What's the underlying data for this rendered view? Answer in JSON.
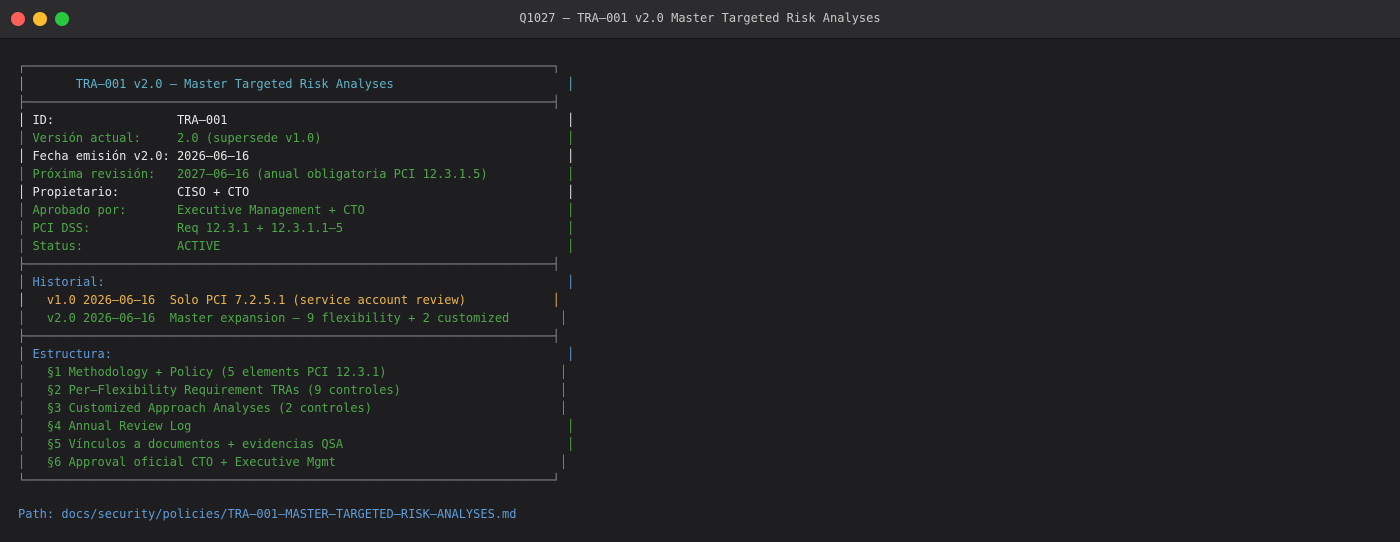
{
  "window": {
    "title": "Q1027 — TRA–001 v2.0 Master Targeted Risk Analyses"
  },
  "colors": {
    "accent_cyan": "#5fb3c9",
    "text_white": "#e6e6e6",
    "status_green": "#4fa64a",
    "history_yellow": "#e9b44c",
    "heading_blue": "#5f9bd8"
  },
  "terminal": {
    "lines": [
      "┌─────────────────────────────────────────────────────────────────────────┐",
      "│       TRA–001 v2.0 — Master Targeted Risk Analyses                        │",
      "├─────────────────────────────────────────────────────────────────────────┤",
      "│ ID:                 TRA–001                                               │",
      "│ Versión actual:     2.0 (supersede v1.0)                                  │",
      "│ Fecha emisión v2.0: 2026–06–16                                            │",
      "│ Próxima revisión:   2027–06–16 (anual obligatoria PCI 12.3.1.5)           │",
      "│ Propietario:        CISO + CTO                                            │",
      "│ Aprobado por:       Executive Management + CTO                            │",
      "│ PCI DSS:            Req 12.3.1 + 12.3.1.1–5                               │",
      "│ Status:             ACTIVE                                                │",
      "├─────────────────────────────────────────────────────────────────────────┤",
      "│ Historial:                                                                │",
      "│   v1.0 2026–06–16  Solo PCI 7.2.5.1 (service account review)            │",
      "│   v2.0 2026–06–16  Master expansion — 9 flexibility + 2 customized       │",
      "├─────────────────────────────────────────────────────────────────────────┤",
      "│ Estructura:                                                               │",
      "│   §1 Methodology + Policy (5 elements PCI 12.3.1)                        │",
      "│   §2 Per–Flexibility Requirement TRAs (9 controles)                      │",
      "│   §3 Customized Approach Analyses (2 controles)                          │",
      "│   §4 Annual Review Log                                                    │",
      "│   §5 Vínculos a documentos + evidencias QSA                               │",
      "│   §6 Approval oficial CTO + Executive Mgmt                               │",
      "└─────────────────────────────────────────────────────────────────────────┘"
    ]
  },
  "footer": {
    "path": "Path: docs/security/policies/TRA–001–MASTER–TARGETED–RISK–ANALYSES.md"
  }
}
